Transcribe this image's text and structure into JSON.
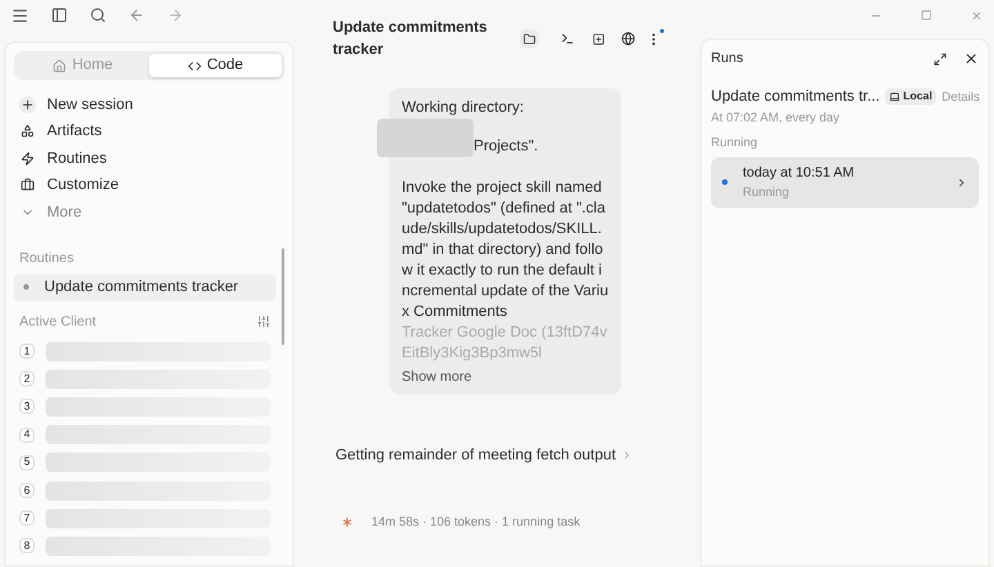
{
  "sidebar": {
    "tabs": [
      {
        "label": "Home",
        "selected": false
      },
      {
        "label": "Code",
        "selected": true
      }
    ],
    "nav": [
      {
        "label": "New session",
        "kind": "new"
      },
      {
        "label": "Artifacts",
        "kind": "artifacts"
      },
      {
        "label": "Routines",
        "kind": "routines"
      },
      {
        "label": "Customize",
        "kind": "customize"
      },
      {
        "label": "More",
        "kind": "more"
      }
    ],
    "routines_heading": "Routines",
    "routines": [
      {
        "label": "Update commitments tracker",
        "selected": true
      }
    ],
    "active_client_heading": "Active Client",
    "clients": [
      {
        "index": "1"
      },
      {
        "index": "2"
      },
      {
        "index": "3"
      },
      {
        "index": "4"
      },
      {
        "index": "5"
      },
      {
        "index": "6"
      },
      {
        "index": "7"
      },
      {
        "index": "8"
      }
    ]
  },
  "session": {
    "title": "Update commitments tracker",
    "message": {
      "line_1": "Working directory:",
      "line_2": "Projects\".",
      "body": "Invoke the project skill named \"updatetodos\" (defined at \".claude/skills/updatetodos/SKILL.md\" in that directory) and follow it exactly to run the default incremental update of the Variux Commitments",
      "faded": "Tracker Google Doc (13ftD74vEitBly3Kig3Bp3mw5l",
      "show_more": "Show more"
    },
    "step": "Getting remainder of meeting fetch output",
    "status": "14m 58s · 106 tokens · 1 running task"
  },
  "runs": {
    "title": "Runs",
    "routine": "Update commitments tr...",
    "location": "Local",
    "details": "Details",
    "schedule": "At 07:02 AM, every day",
    "section": "Running",
    "items": [
      {
        "time": "today at 10:51 AM",
        "status": "Running",
        "color": "#1a73e8"
      }
    ]
  }
}
